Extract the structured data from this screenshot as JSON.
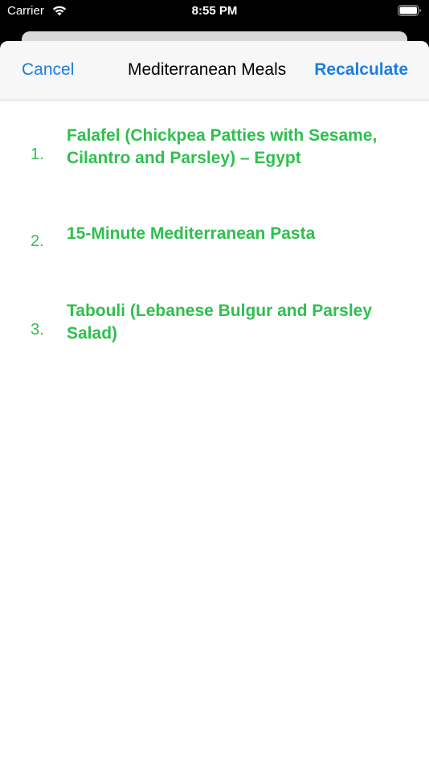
{
  "status_bar": {
    "carrier": "Carrier",
    "time": "8:55 PM"
  },
  "nav": {
    "cancel_label": "Cancel",
    "title": "Mediterranean Meals",
    "recalculate_label": "Recalculate"
  },
  "meals": [
    {
      "number": "1.",
      "name": "Falafel (Chickpea Patties with Sesame, Cilantro and Parsley) – Egypt"
    },
    {
      "number": "2.",
      "name": "15-Minute Mediterranean Pasta"
    },
    {
      "number": "3.",
      "name": "Tabouli (Lebanese Bulgur and Parsley Salad)"
    }
  ],
  "colors": {
    "accent_blue": "#1a7ee3",
    "meal_green": "#2fbf4f"
  }
}
